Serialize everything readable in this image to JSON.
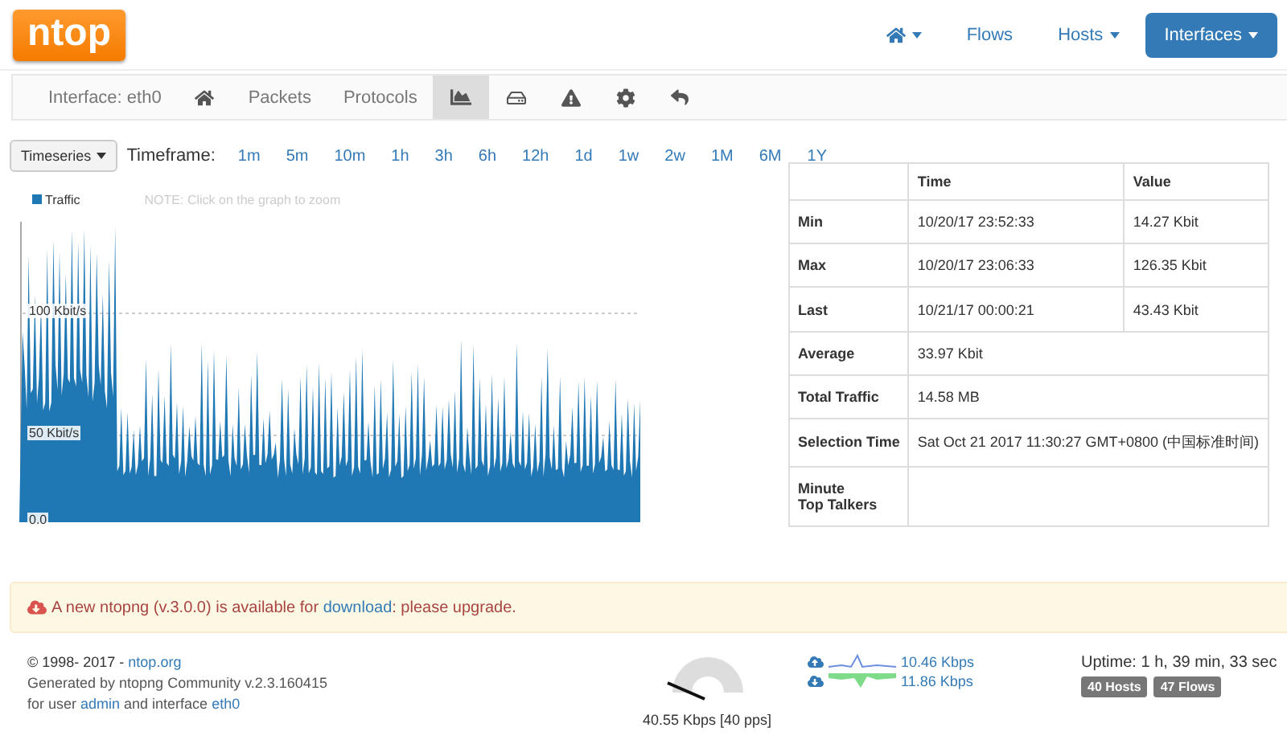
{
  "logo": {
    "text": "ntop"
  },
  "top_nav": [
    {
      "kind": "icon",
      "dropdown": true,
      "selected": false
    },
    {
      "kind": "text",
      "label": "Flows",
      "dropdown": false,
      "selected": false
    },
    {
      "kind": "text",
      "label": "Hosts",
      "dropdown": true,
      "selected": false
    },
    {
      "kind": "text",
      "label": "Interfaces",
      "dropdown": true,
      "selected": true
    }
  ],
  "sub_nav": [
    {
      "kind": "label",
      "label": "Interface: eth0",
      "selected": false
    },
    {
      "kind": "icon",
      "selected": false
    },
    {
      "kind": "text",
      "label": "Packets",
      "selected": false
    },
    {
      "kind": "text",
      "label": "Protocols",
      "selected": false
    },
    {
      "kind": "icon",
      "selected": true
    },
    {
      "kind": "icon",
      "selected": false
    },
    {
      "kind": "icon",
      "selected": false
    },
    {
      "kind": "icon",
      "selected": false
    },
    {
      "kind": "icon",
      "selected": false
    }
  ],
  "timeseries_button": "Timeseries",
  "timeframe_label": "Timeframe:",
  "timeframes": [
    "1m",
    "5m",
    "10m",
    "1h",
    "3h",
    "6h",
    "12h",
    "1d",
    "1w",
    "2w",
    "1M",
    "6M",
    "1Y"
  ],
  "graph": {
    "legend": "Traffic",
    "note": "NOTE: Click on the graph to zoom",
    "axis_labels": [
      "100 Kbit/s",
      "50 Kbit/s",
      "0.0"
    ]
  },
  "stats_table": {
    "columns": [
      "",
      "Time",
      "Value"
    ],
    "rows": [
      {
        "cells": [
          "Min",
          "10/20/17 23:52:33",
          "14.27 Kbit"
        ]
      },
      {
        "cells": [
          "Max",
          "10/20/17 23:06:33",
          "126.35 Kbit"
        ]
      },
      {
        "cells": [
          "Last",
          "10/21/17 00:00:21",
          "43.43 Kbit"
        ]
      },
      {
        "cells": [
          "Average",
          {
            "text": "33.97 Kbit",
            "colspan": 2
          }
        ]
      },
      {
        "cells": [
          "Total Traffic",
          {
            "text": "14.58 MB",
            "colspan": 2
          }
        ]
      },
      {
        "cells": [
          "Selection Time",
          {
            "text": "Sat Oct 21 2017 11:30:27 GMT+0800 (中国标准时间)",
            "colspan": 2
          }
        ]
      },
      {
        "cells": [
          "Minute\nTop Talkers"
        ]
      }
    ]
  },
  "alert": {
    "before": "A new ntopng (v.3.0.0) is available for ",
    "link": "download",
    "after": ": please upgrade."
  },
  "footer": {
    "copyright": "© 1998- 2017 - ",
    "copyright_link": "ntop.org",
    "generated": "Generated by ntopng Community v.2.3.160415",
    "user_prefix": "for user ",
    "user": "admin",
    "user_middle": " and interface ",
    "interface": "eth0",
    "gauge_reading": "40.55 Kbps [40 pps]",
    "upload": "10.46 Kbps",
    "download": "11.86 Kbps",
    "uptime": "Uptime: 1 h, 39 min, 33 sec",
    "badges": [
      "40 Hosts",
      "47 Flows"
    ]
  }
}
